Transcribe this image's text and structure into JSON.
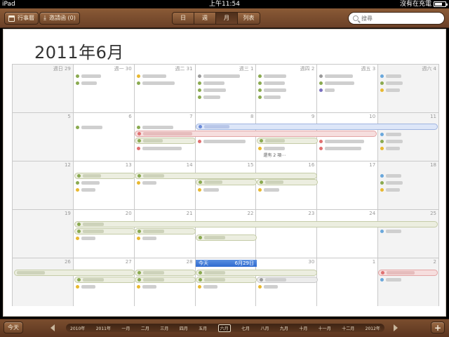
{
  "status": {
    "device": "iPad",
    "time": "上午11:54",
    "charge": "沒有在充電"
  },
  "toolbar": {
    "calendars_label": "行事曆",
    "invites_label": "邀請函 (0)",
    "views": [
      "日",
      "週",
      "月",
      "列表"
    ],
    "active_view": "月",
    "search_placeholder": "搜尋"
  },
  "month_title": "2011年6月",
  "weekday_labels": [
    "週日",
    "週一",
    "週二",
    "週三",
    "週四",
    "週五",
    "週六"
  ],
  "weeks": [
    [
      "週日 29",
      "週一 30",
      "週二 31",
      "週三 1",
      "週四 2",
      "週五 3",
      "週六 4"
    ],
    [
      "5",
      "6",
      "7",
      "8",
      "9",
      "10",
      "11"
    ],
    [
      "12",
      "13",
      "14",
      "15",
      "16",
      "17",
      "18"
    ],
    [
      "19",
      "20",
      "21",
      "22",
      "23",
      "24",
      "25"
    ],
    [
      "26",
      "27",
      "28",
      "",
      "30",
      "1",
      "2"
    ]
  ],
  "today": {
    "label": "今天",
    "date": "6月29日"
  },
  "more_label": "還有 2 項⋯",
  "bottom": {
    "today_button": "今天",
    "timeline": [
      "2010年",
      "2011年",
      "一月",
      "二月",
      "三月",
      "四月",
      "五月",
      "六月",
      "七月",
      "八月",
      "九月",
      "十月",
      "十一月",
      "十二月",
      "2012年"
    ],
    "active_month": "六月",
    "add_label": "+"
  },
  "colors": {
    "green": "#8aaa50",
    "yellow": "#e8b830",
    "blue": "#6aa8dc",
    "red": "#e07070",
    "gray": "#9a9a9a",
    "purple": "#7a70c0"
  }
}
